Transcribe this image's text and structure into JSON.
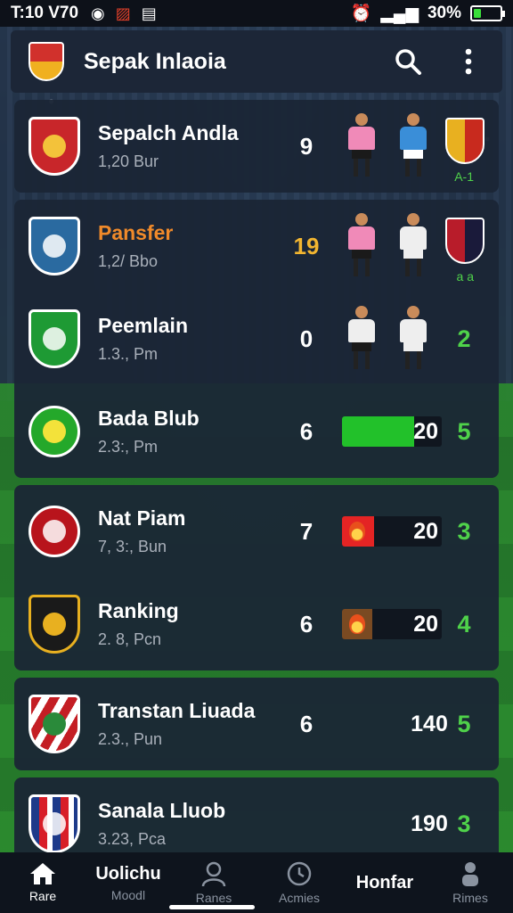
{
  "status_bar": {
    "time": "T:10 V70",
    "battery_text": "30%",
    "battery_level": 0.3
  },
  "app_bar": {
    "title": "Sepak Inlaoia"
  },
  "teams": [
    {
      "name": "Sepalch Andla",
      "sub": "1,20 Bur",
      "score": "9",
      "extra": "A-1",
      "crest_color": "#c8262a"
    },
    {
      "name": "Pansfer",
      "sub": "1,2/ Bbo",
      "score": "19",
      "extra": "a a",
      "crest_color": "#2a6aa0"
    },
    {
      "name": "Peemlain",
      "sub": "1.3., Pm",
      "score": "0",
      "right_score": "2",
      "crest_color": "#1e9a34"
    },
    {
      "name": "Bada Blub",
      "sub": "2.3:, Pm",
      "score": "6",
      "bar_value": "20",
      "bar_fill": 0.72,
      "bar_color": "#22c12a",
      "right_score": "5",
      "crest_color": "#24a82a"
    },
    {
      "name": "Nat Piam",
      "sub": "7, 3:, Bun",
      "score": "7",
      "bar_value": "20",
      "bar_fill": 0.32,
      "bar_color": "#e42424",
      "right_score": "3",
      "crest_color": "#b8141c"
    },
    {
      "name": "Ranking",
      "sub": "2. 8, Pcn",
      "score": "6",
      "bar_value": "20",
      "bar_fill": 0.3,
      "bar_color": "#7a4a22",
      "right_score": "4",
      "crest_color": "#1a1a1a"
    },
    {
      "name": "Transtan Liuada",
      "sub": "2.3., Pun",
      "score": "6",
      "big_num": "140",
      "right_score": "5",
      "crest_color": "#c41e24"
    },
    {
      "name": "Sanala Lluob",
      "sub": "3.23, Pca",
      "big_num": "190",
      "right_score": "3",
      "crest_color": "#1d3a8a"
    }
  ],
  "bottom_nav": {
    "home": "Rare",
    "item2_top": "Uolichu",
    "item2": "Moodl",
    "item3": "Ranes",
    "item4": "Acmies",
    "item5": "Honfar",
    "item6": "Rimes"
  }
}
